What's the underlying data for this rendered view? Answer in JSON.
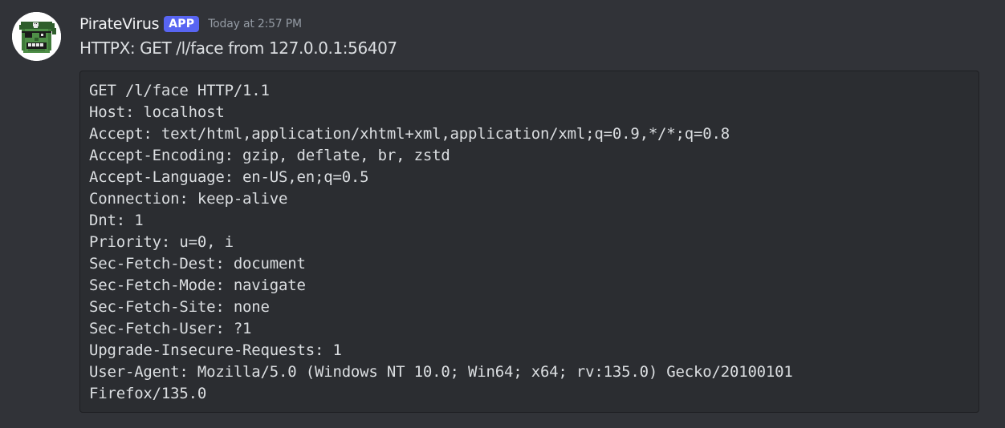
{
  "message": {
    "username": "PirateVirus",
    "badge": "APP",
    "timestamp": "Today at 2:57 PM",
    "text": "HTTPX: GET /l/face from 127.0.0.1:56407",
    "avatar_icon": "pirate-skull-icon"
  },
  "code_block": {
    "lines": [
      "GET /l/face HTTP/1.1",
      "Host: localhost",
      "Accept: text/html,application/xhtml+xml,application/xml;q=0.9,*/*;q=0.8",
      "Accept-Encoding: gzip, deflate, br, zstd",
      "Accept-Language: en-US,en;q=0.5",
      "Connection: keep-alive",
      "Dnt: 1",
      "Priority: u=0, i",
      "Sec-Fetch-Dest: document",
      "Sec-Fetch-Mode: navigate",
      "Sec-Fetch-Site: none",
      "Sec-Fetch-User: ?1",
      "Upgrade-Insecure-Requests: 1",
      "User-Agent: Mozilla/5.0 (Windows NT 10.0; Win64; x64; rv:135.0) Gecko/20100101",
      "Firefox/135.0"
    ]
  },
  "colors": {
    "background": "#313338",
    "code_background": "#2b2d31",
    "badge": "#5865f2",
    "timestamp": "#949ba4",
    "avatar_green": "#3f7a3a"
  }
}
